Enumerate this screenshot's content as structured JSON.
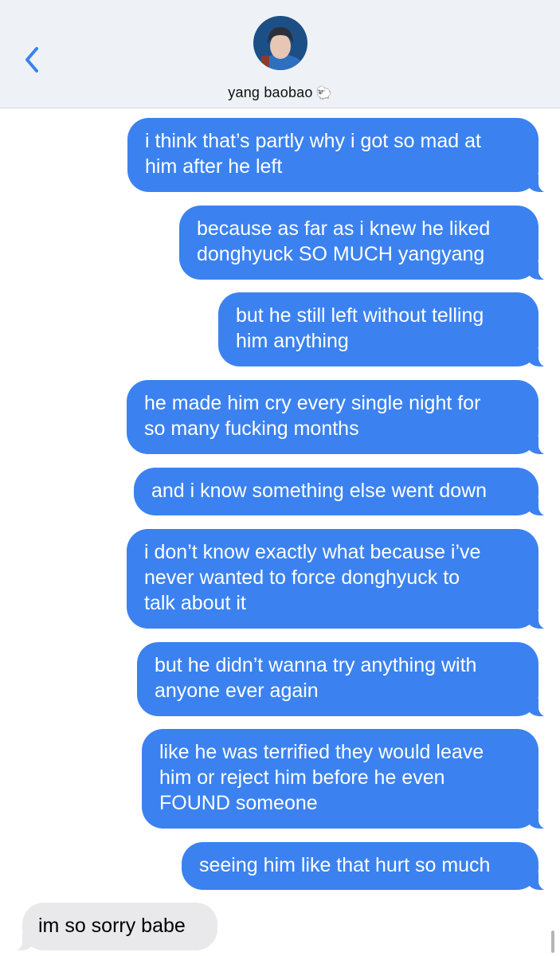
{
  "header": {
    "contact_name": "yang baobao",
    "contact_emoji": "🐑"
  },
  "messages": [
    {
      "from": "me",
      "text": "i think that’s partly why i got so mad at\nhim after he left"
    },
    {
      "from": "me",
      "text": "because as far as i knew he liked\ndonghyuck SO MUCH yangyang"
    },
    {
      "from": "me",
      "text": "but he still left without telling\nhim anything"
    },
    {
      "from": "me",
      "text": "he made him cry every single night for\nso many fucking months"
    },
    {
      "from": "me",
      "text": "and i know something else went down"
    },
    {
      "from": "me",
      "text": "i don’t know exactly what because i’ve\nnever wanted to force donghyuck to\ntalk about it"
    },
    {
      "from": "me",
      "text": "but he didn’t wanna try anything with\nanyone ever again"
    },
    {
      "from": "me",
      "text": "like he was terrified they would leave\nhim or reject him before he even\nFOUND someone"
    },
    {
      "from": "me",
      "text": "seeing him like that hurt so much"
    },
    {
      "from": "them",
      "text": "im so sorry babe"
    }
  ],
  "colors": {
    "sent_bubble": "#3b82f0",
    "received_bubble": "#e9e9eb",
    "header_bg": "#eef2f6",
    "accent": "#3b82f0"
  },
  "icons": {
    "back": "chevron-left-icon"
  }
}
